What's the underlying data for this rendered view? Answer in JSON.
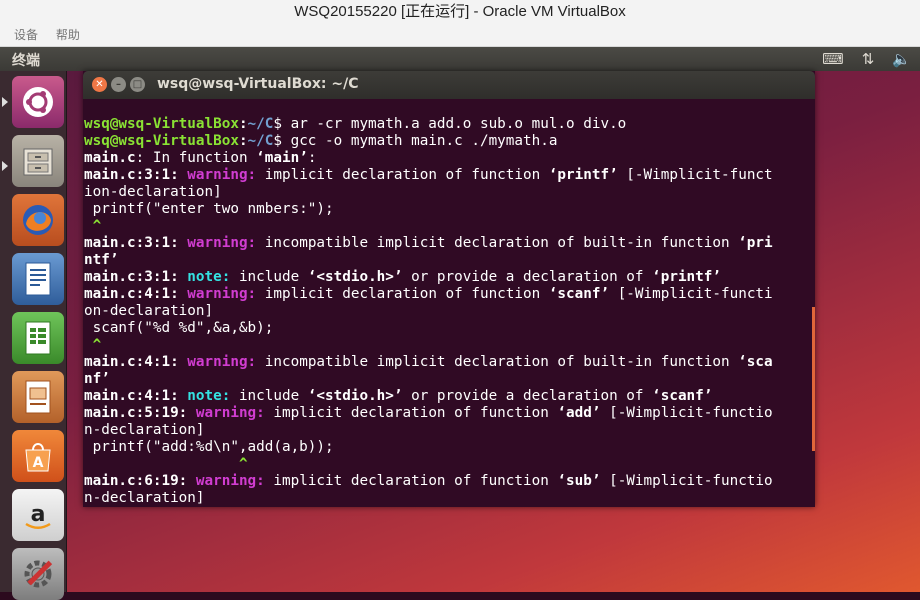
{
  "vbox": {
    "title": "WSQ20155220 [正在运行] - Oracle VM VirtualBox",
    "menu": [
      "设备",
      "帮助"
    ]
  },
  "panel": {
    "app_title": "终端"
  },
  "launcher": {
    "items": [
      "ubuntu-icon",
      "files-icon",
      "firefox-icon",
      "writer-icon",
      "calc-icon",
      "impress-icon",
      "software-center-icon",
      "amazon-icon",
      "settings-icon"
    ]
  },
  "terminal": {
    "title": "wsq@wsq-VirtualBox: ~/C",
    "prompt_user": "wsq@wsq-VirtualBox",
    "prompt_path": "~/C",
    "cmd1": " ar -cr mymath.a add.o sub.o mul.o div.o",
    "cmd2": " gcc -o mymath main.c ./mymath.a",
    "l_func": ": In function ",
    "l_func_name": "‘main’",
    "main_c": "main.c",
    "loc_3_1": "main.c:3:1:",
    "loc_4_1": "main.c:4:1:",
    "loc_5_19": "main.c:5:19:",
    "loc_6_19": "main.c:6:19:",
    "warning": "warning:",
    "note": "note:",
    "implicit": " implicit declaration of function ",
    "incompat": " incompatible implicit declaration of built-in function ",
    "include": " include ",
    "stdio": "‘<stdio.h>’",
    "provide": " or provide a declaration of ",
    "printf_q": "‘printf’",
    "scanf_q": "‘scanf’",
    "add_q": "‘add’",
    "sub_q": "‘sub’",
    "pri": "‘pri",
    "ntf": "ntf’",
    "sca": "‘sca",
    "nf": "nf’",
    "w1_tail": " [-Wimplicit-funct",
    "w1_wrap": "ion-declaration]",
    "w2_tail": " [-Wimplicit-functi",
    "w2_wrap": "on-declaration]",
    "w3_tail": " [-Wimplicit-functio",
    "w3_wrap": "n-declaration]",
    "src1": " printf(\"enter two nmbers:\");",
    "src2": " scanf(\"%d %d\",&a,&b);",
    "src3": " printf(\"add:%d\\n\",add(a,b));",
    "caret": "^"
  }
}
